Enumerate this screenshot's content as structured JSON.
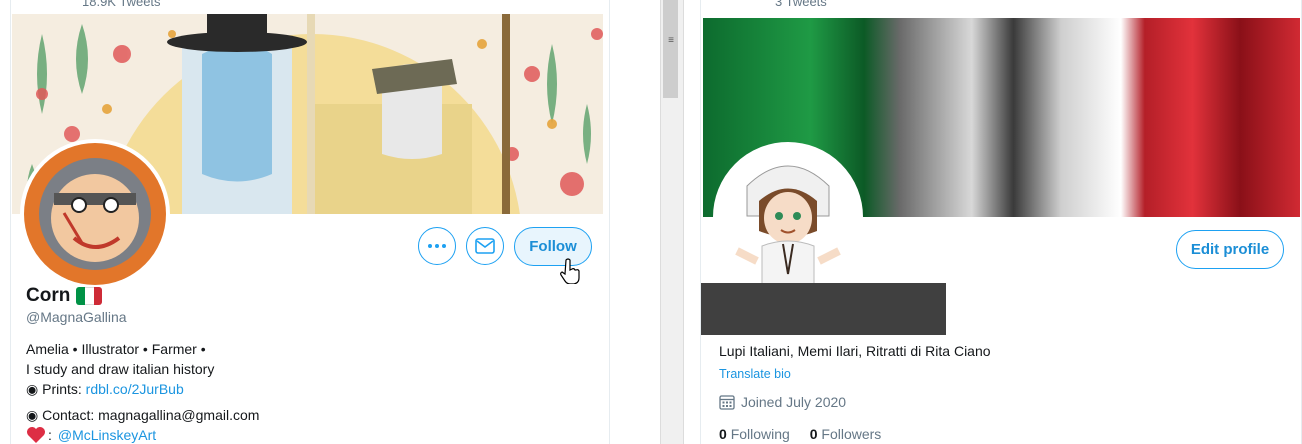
{
  "left_profile": {
    "tweets_count": "18.9K Tweets",
    "name": "Corn",
    "handle": "@MagnaGallina",
    "bio_line1": "Amelia • Illustrator • Farmer •",
    "bio_line2": "I study and draw italian history",
    "prints_label": "◉ Prints:",
    "prints_link": "rdbl.co/2JurBub",
    "contact_label": "◉ Contact: magnagallina@gmail.com",
    "heart_suffix": ":",
    "heart_link": "@McLinskeyArt",
    "follow_label": "Follow",
    "more_icon": "more-dots-icon",
    "message_icon": "envelope-icon"
  },
  "right_profile": {
    "tweets_count": "3 Tweets",
    "edit_label": "Edit profile",
    "bio": "Lupi Italiani, Memi Ilari, Ritratti di Rita Ciano",
    "translate": "Translate bio",
    "joined": "Joined July 2020",
    "following_count": "0",
    "following_label": "Following",
    "followers_count": "0",
    "followers_label": "Followers"
  },
  "colors": {
    "accent": "#1da1f2",
    "flag_green": "#009246",
    "flag_white": "#ffffff",
    "flag_red": "#ce2b37",
    "redaction": "#404040"
  }
}
